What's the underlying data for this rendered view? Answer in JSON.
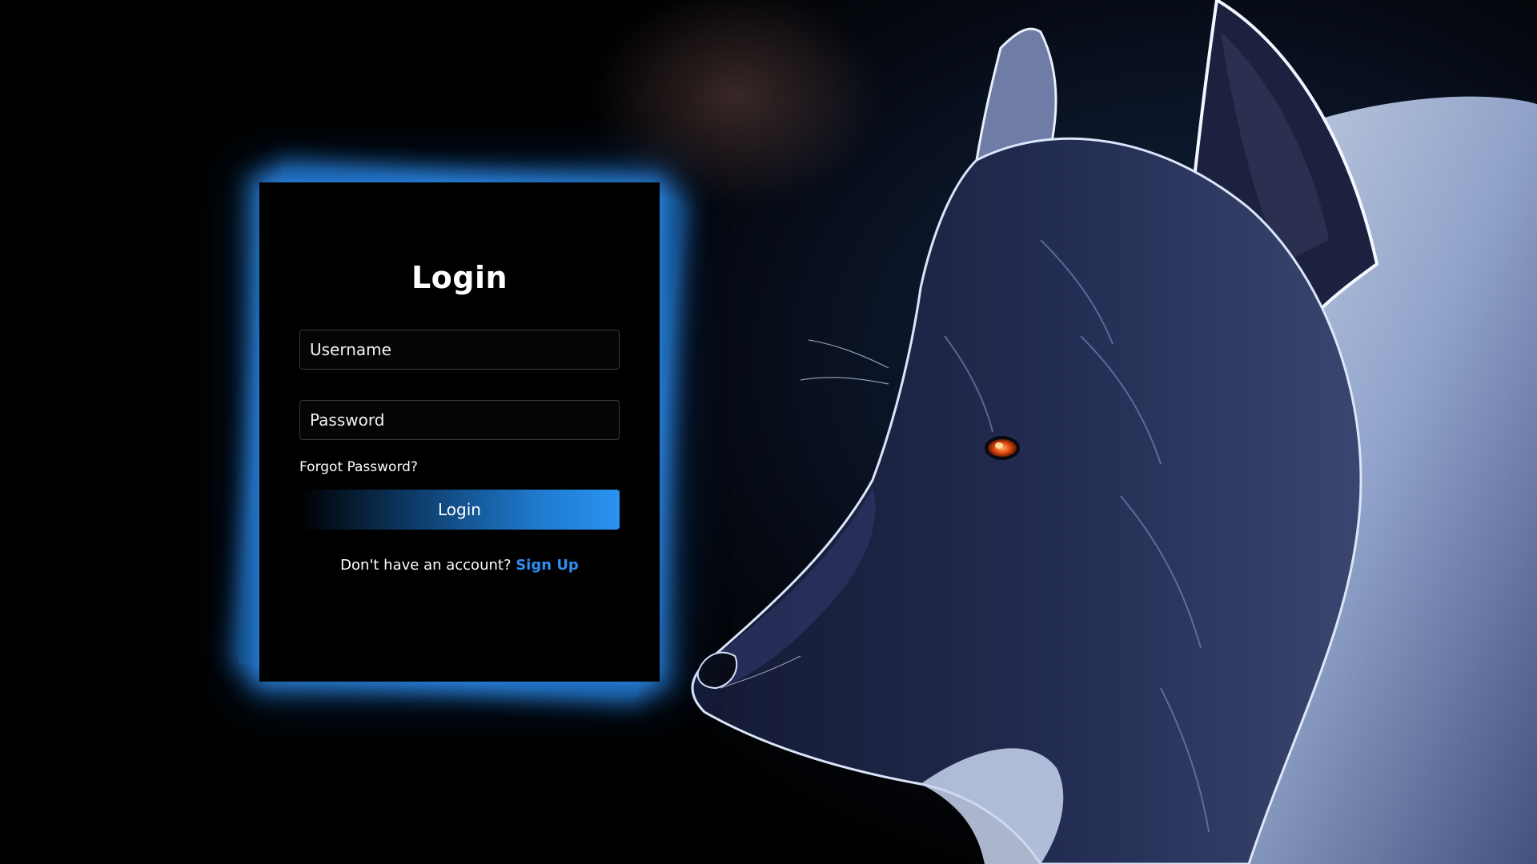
{
  "background": {
    "artwork_icon": "wolf-icon",
    "accent_glow": "#2e8ff0"
  },
  "login": {
    "title": "Login",
    "username_placeholder": "Username",
    "password_placeholder": "Password",
    "forgot_label": "Forgot Password?",
    "submit_label": "Login",
    "signup_prompt": "Don't have an account?",
    "signup_link": "Sign Up"
  }
}
